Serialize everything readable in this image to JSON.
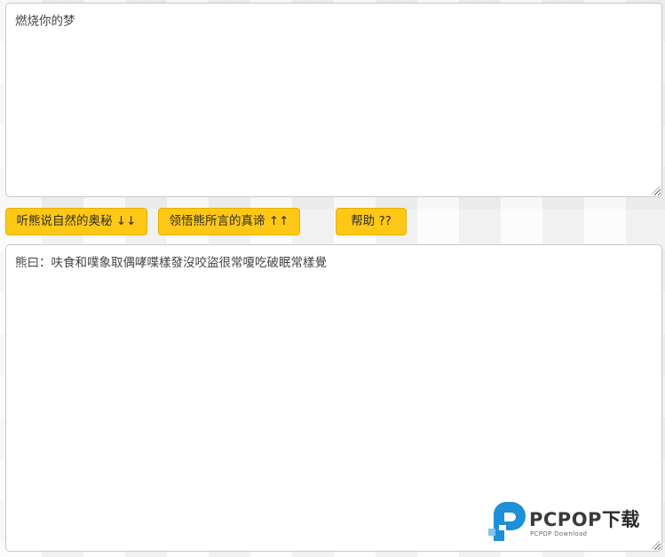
{
  "input": {
    "text": "燃烧你的梦"
  },
  "buttons": {
    "decode_label": "听熊说自然的奥秘 ↓↓",
    "encode_label": "领悟熊所言的真谛 ↑↑",
    "help_label": "帮助 ??"
  },
  "output": {
    "text": "熊曰：呋食和噗象取偶哮喋樣發沒咬盜很常嗄吃破眠常樣覺"
  },
  "watermark": {
    "brand_main": "PCPOP",
    "brand_cn": "下载",
    "subtitle": "PCPOP Download",
    "logo_icon": "pcpop-logo-icon",
    "colors": {
      "logo_blue": "#1f8fd8",
      "logo_light_blue": "#7ec3ef"
    }
  },
  "colors": {
    "button_bg": "#ffc817",
    "button_border": "#e3b100",
    "textarea_bg": "#ffffff",
    "textarea_border": "#c8c8c8"
  }
}
